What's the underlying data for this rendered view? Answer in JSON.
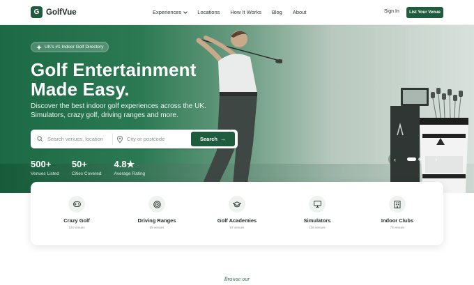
{
  "nav": {
    "logo_letter": "G",
    "logo_text": "GolfVue",
    "menu": [
      "Experiences",
      "Locations",
      "How It Works",
      "Blog",
      "About"
    ],
    "signin": "Sign In",
    "cta": "List Your Venue"
  },
  "hero": {
    "badge": "UK's #1 Indoor Golf Directory",
    "title_line1": "Golf Entertainment",
    "title_line2": "Made Easy.",
    "subtitle_line1": "Discover the best indoor golf experiences across the UK.",
    "subtitle_line2": "Simulators, crazy golf, driving ranges and more.",
    "search": {
      "venue_placeholder": "Search venues, location",
      "city_placeholder": "City or postcode",
      "button": "Search"
    },
    "stats": [
      {
        "value": "500+",
        "label": "Venues Listed"
      },
      {
        "value": "50+",
        "label": "Cities Covered"
      },
      {
        "value": "4.8★",
        "label": "Average Rating"
      }
    ],
    "carousel": {
      "prev": "‹",
      "next": "›"
    }
  },
  "categories": [
    {
      "name": "Crazy Golf",
      "count": "124 venues",
      "icon": "gamepad-icon"
    },
    {
      "name": "Driving Ranges",
      "count": "89 venues",
      "icon": "target-icon"
    },
    {
      "name": "Golf Academies",
      "count": "67 venues",
      "icon": "graduation-cap-icon"
    },
    {
      "name": "Simulators",
      "count": "156 venues",
      "icon": "monitor-icon"
    },
    {
      "name": "Indoor Clubs",
      "count": "78 venues",
      "icon": "building-icon"
    }
  ],
  "browse": "Browse our",
  "colors": {
    "brand": "#1f5b3d",
    "hero_green": "#1c6a45"
  }
}
